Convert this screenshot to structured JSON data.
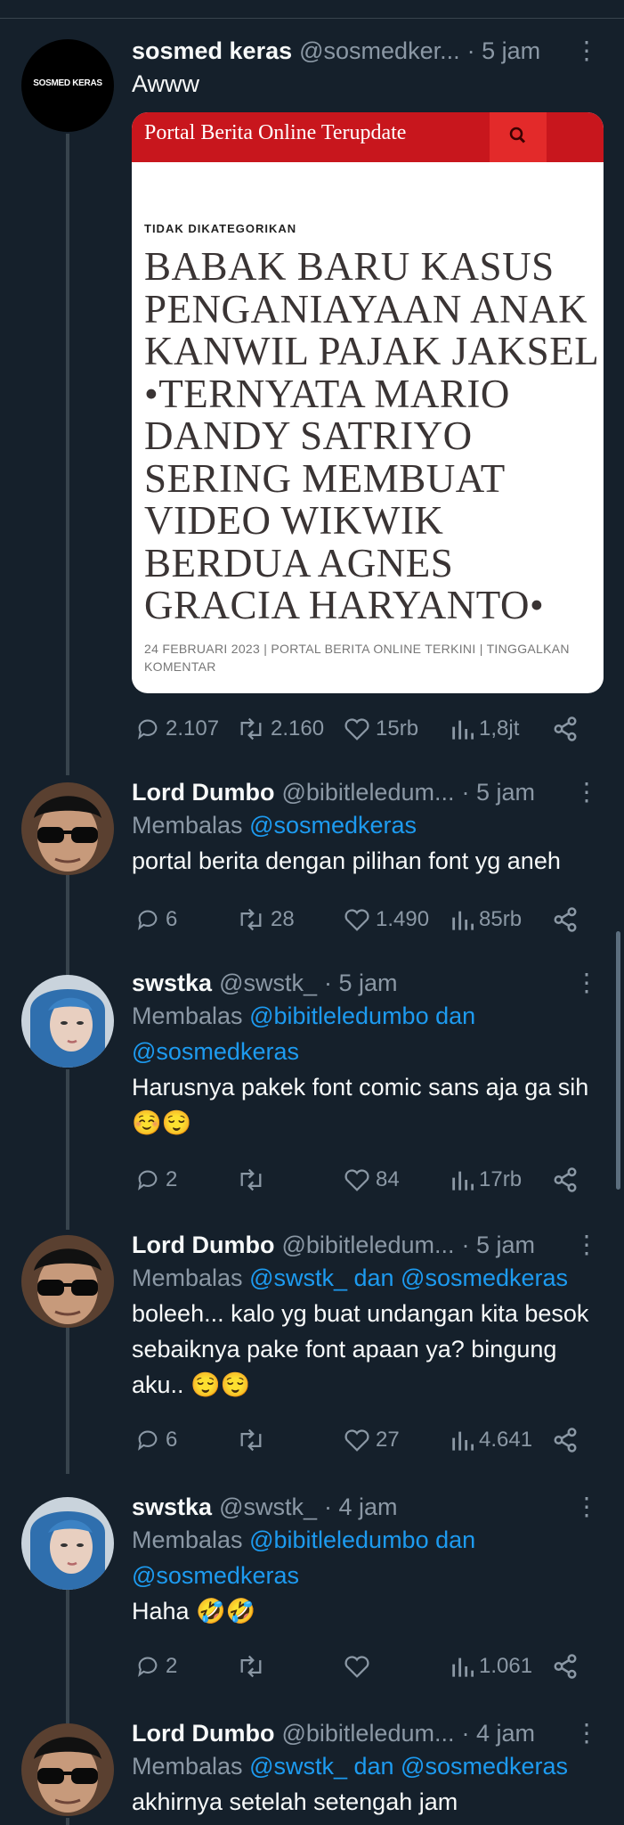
{
  "tweets": [
    {
      "name": "sosmed keras",
      "handle": "@sosmedker...",
      "time": "· 5 jam",
      "avatar_text": "SOSMED KERAS",
      "text": "Awww",
      "card": {
        "site_title": "Portal Berita Online Terupdate",
        "category": "TIDAK DIKATEGORIKAN",
        "headline": "BABAK BARU KASUS PENGANIAYAAN ANAK KANWIL PAJAK JAKSEL •TERNYATA MARIO DANDY SATRIYO SERING MEMBUAT VIDEO WIKWIK BERDUA AGNES GRACIA HARYANTO•",
        "meta": "24 FEBRUARI 2023 | PORTAL BERITA ONLINE TERKINI | TINGGALKAN KOMENTAR"
      },
      "stats": {
        "replies": "2.107",
        "retweets": "2.160",
        "likes": "15rb",
        "views": "1,8jt"
      }
    },
    {
      "name": "Lord Dumbo",
      "handle": "@bibitleledum...",
      "time": "· 5 jam",
      "reply_prefix": "Membalas",
      "reply_mentions": "@sosmedkeras",
      "text": "portal berita dengan pilihan font yg aneh",
      "stats": {
        "replies": "6",
        "retweets": "28",
        "likes": "1.490",
        "views": "85rb"
      }
    },
    {
      "name": "swstka",
      "handle": "@swstk_",
      "time": "· 5 jam",
      "reply_prefix": "Membalas",
      "reply_mentions_1": "@bibitleledumbo dan",
      "reply_mentions_2": "@sosmedkeras",
      "text": "Harusnya pakek font comic sans aja ga sih ☺️😌",
      "stats": {
        "replies": "2",
        "retweets": "",
        "likes": "84",
        "views": "17rb"
      }
    },
    {
      "name": "Lord Dumbo",
      "handle": "@bibitleledum...",
      "time": "· 5 jam",
      "reply_prefix": "Membalas",
      "reply_mentions": "@swstk_ dan @sosmedkeras",
      "text": "boleeh... kalo yg buat undangan kita besok sebaiknya pake font apaan ya? bingung aku.. 😌😌",
      "stats": {
        "replies": "6",
        "retweets": "",
        "likes": "27",
        "views": "4.641"
      }
    },
    {
      "name": "swstka",
      "handle": "@swstk_",
      "time": "· 4 jam",
      "reply_prefix": "Membalas",
      "reply_mentions_1": "@bibitleledumbo dan",
      "reply_mentions_2": "@sosmedkeras",
      "text": "Haha 🤣🤣",
      "stats": {
        "replies": "2",
        "retweets": "",
        "likes": "",
        "views": "1.061"
      }
    },
    {
      "name": "Lord Dumbo",
      "handle": "@bibitleledum...",
      "time": "· 4 jam",
      "reply_prefix": "Membalas",
      "reply_mentions": "@swstk_ dan @sosmedkeras",
      "text": "akhirnya setelah setengah jam"
    }
  ],
  "colors": {
    "background": "#15202b",
    "accent": "#1d9bf0",
    "muted": "#8b98a5",
    "card_bar": "#c8161d"
  }
}
